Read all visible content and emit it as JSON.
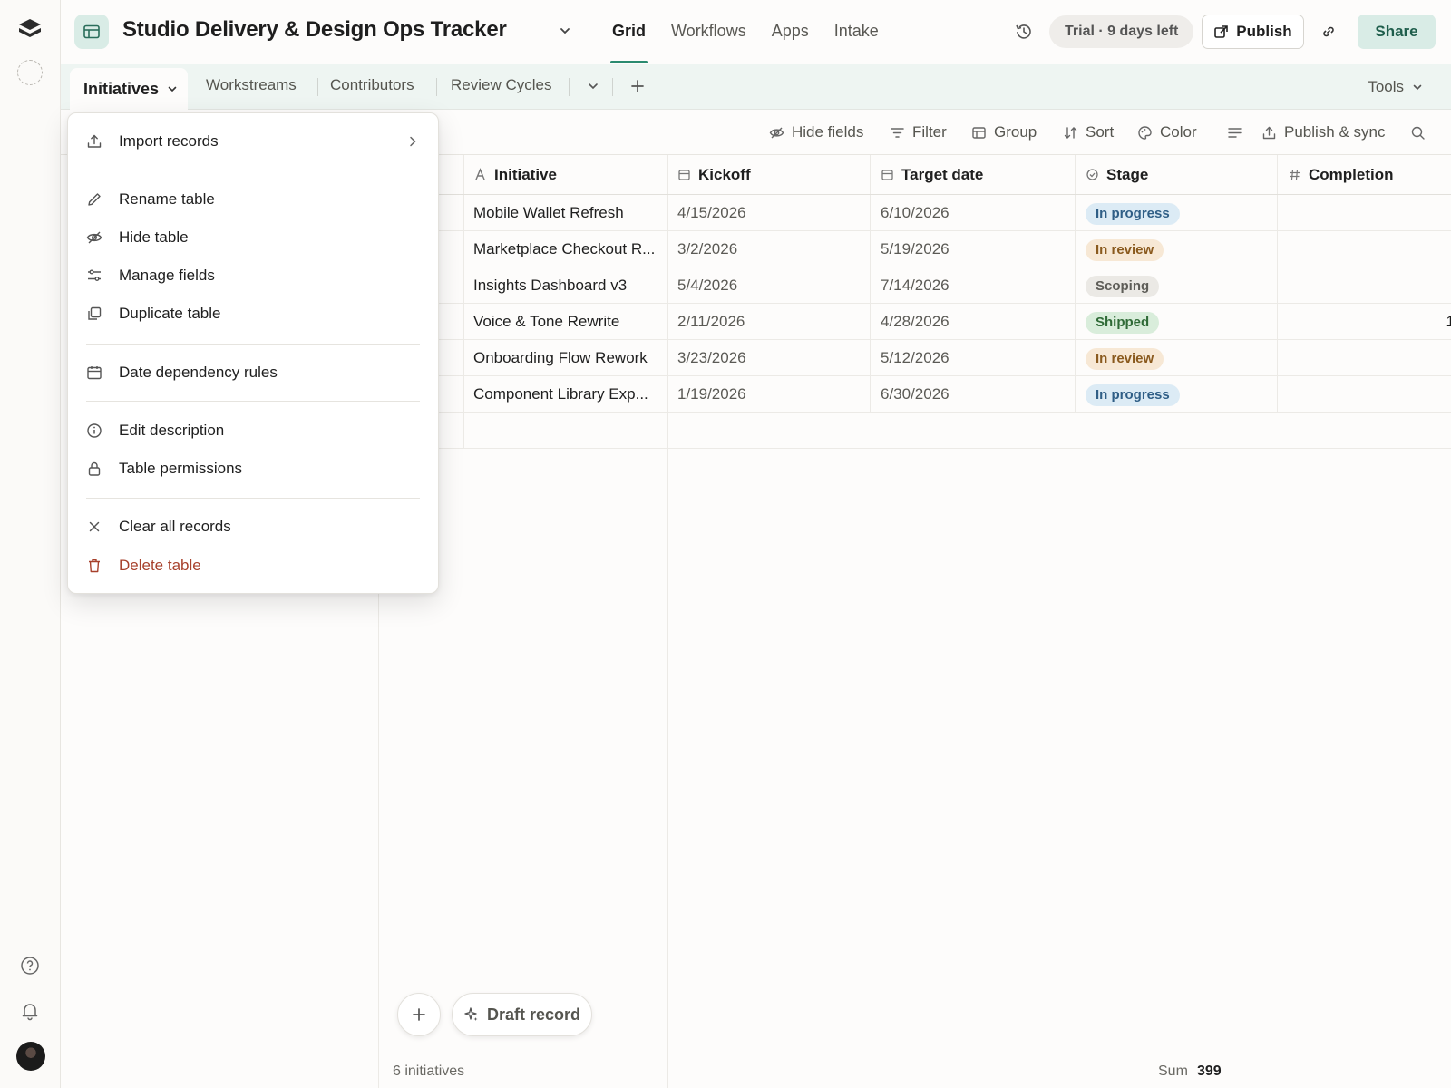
{
  "header": {
    "base_title": "Studio Delivery & Design Ops Tracker",
    "nav_tabs": [
      "Grid",
      "Workflows",
      "Apps",
      "Intake"
    ],
    "active_nav": "Grid",
    "trial_badge": "Trial · 9 days left",
    "publish_label": "Publish",
    "share_label": "Share"
  },
  "tables": {
    "active": "Initiatives",
    "others": [
      "Workstreams",
      "Contributors",
      "Review Cycles"
    ],
    "tools_label": "Tools"
  },
  "toolbar": {
    "hide_fields": "Hide fields",
    "filter": "Filter",
    "group": "Group",
    "sort": "Sort",
    "color": "Color",
    "publish_sync": "Publish & sync"
  },
  "grid": {
    "columns": [
      "Initiative",
      "Kickoff",
      "Target date",
      "Stage",
      "Completion"
    ],
    "rows": [
      {
        "initiative": "Mobile Wallet Refresh",
        "kickoff": "4/15/2026",
        "target": "6/10/2026",
        "stage": "In progress"
      },
      {
        "initiative": "Marketplace Checkout R...",
        "kickoff": "3/2/2026",
        "target": "5/19/2026",
        "stage": "In review"
      },
      {
        "initiative": "Insights Dashboard v3",
        "kickoff": "5/4/2026",
        "target": "7/14/2026",
        "stage": "Scoping"
      },
      {
        "initiative": "Voice & Tone Rewrite",
        "kickoff": "2/11/2026",
        "target": "4/28/2026",
        "stage": "Shipped",
        "completion_partial": "1"
      },
      {
        "initiative": "Onboarding Flow Rework",
        "kickoff": "3/23/2026",
        "target": "5/12/2026",
        "stage": "In review"
      },
      {
        "initiative": "Component Library Exp...",
        "kickoff": "1/19/2026",
        "target": "6/30/2026",
        "stage": "In progress"
      }
    ],
    "draft_label": "Draft record"
  },
  "footer": {
    "count": "6 initiatives",
    "sum_label": "Sum",
    "sum_value": "399"
  },
  "menu": {
    "items": [
      "Import records",
      "Rename table",
      "Hide table",
      "Manage fields",
      "Duplicate table",
      "Date dependency rules",
      "Edit description",
      "Table permissions",
      "Clear all records",
      "Delete table"
    ]
  },
  "colors": {
    "accent": "#2a8a6f",
    "share_bg": "#d9ece6",
    "danger": "#a7412c"
  }
}
